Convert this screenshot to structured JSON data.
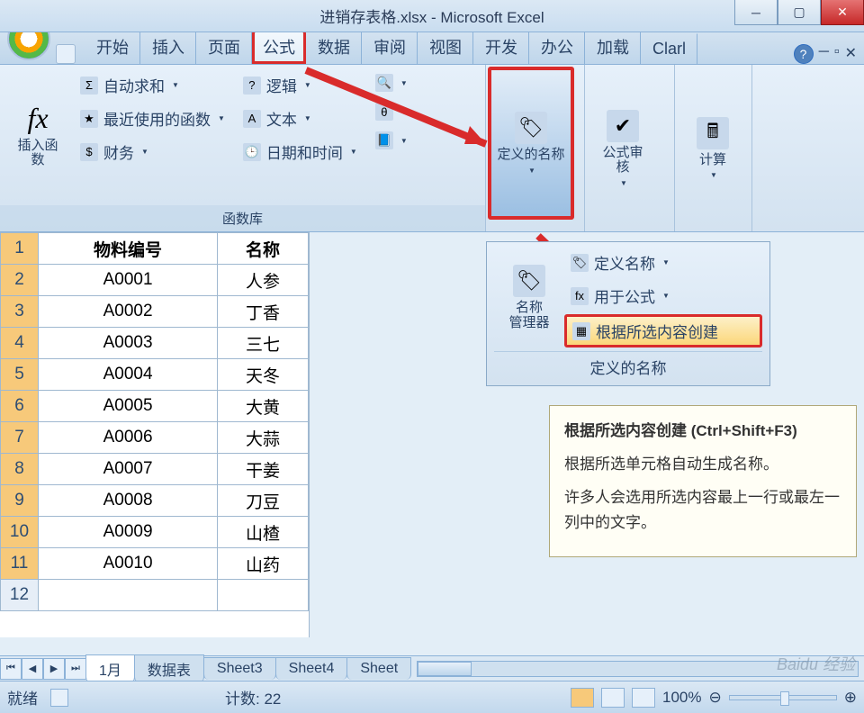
{
  "window": {
    "title": "进销存表格.xlsx - Microsoft Excel"
  },
  "tabs": {
    "start": "开始",
    "insert": "插入",
    "page": "页面",
    "formula": "公式",
    "data": "数据",
    "review": "审阅",
    "view": "视图",
    "dev": "开发",
    "office": "办公",
    "addins": "加载",
    "clari": "Clarl"
  },
  "ribbon": {
    "insertfn": "插入函数",
    "autosum": "自动求和",
    "recent": "最近使用的函数",
    "financial": "财务",
    "logical": "逻辑",
    "text": "文本",
    "datetime": "日期和时间",
    "funclib": "函数库",
    "defname_big": "定义的名称",
    "audit": "公式审核",
    "calc": "计算"
  },
  "namepanel": {
    "manager": "名称\n管理器",
    "define": "定义名称",
    "usein": "用于公式",
    "create": "根据所选内容创建",
    "label": "定义的名称"
  },
  "tooltip": {
    "title": "根据所选内容创建 (Ctrl+Shift+F3)",
    "body1": "根据所选单元格自动生成名称。",
    "body2": "许多人会选用所选内容最上一行或最左一列中的文字。"
  },
  "table": {
    "headers": {
      "code": "物料编号",
      "name": "名称"
    },
    "rows": [
      {
        "code": "A0001",
        "name": "人参"
      },
      {
        "code": "A0002",
        "name": "丁香"
      },
      {
        "code": "A0003",
        "name": "三七"
      },
      {
        "code": "A0004",
        "name": "天冬"
      },
      {
        "code": "A0005",
        "name": "大黄"
      },
      {
        "code": "A0006",
        "name": "大蒜"
      },
      {
        "code": "A0007",
        "name": "干姜"
      },
      {
        "code": "A0008",
        "name": "刀豆"
      },
      {
        "code": "A0009",
        "name": "山楂"
      },
      {
        "code": "A0010",
        "name": "山药"
      }
    ]
  },
  "sheets": {
    "s1": "1月",
    "s2": "数据表",
    "s3": "Sheet3",
    "s4": "Sheet4",
    "s5": "Sheet"
  },
  "status": {
    "ready": "就绪",
    "count": "计数: 22",
    "zoom": "100%"
  },
  "watermark": "Baidu 经验"
}
